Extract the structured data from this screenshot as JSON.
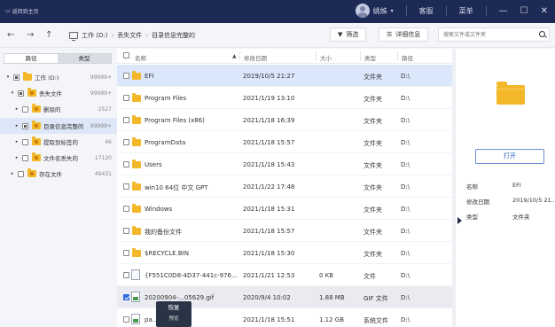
{
  "titlebar": {
    "back_label": "返回到主页",
    "user_name": "姚姊",
    "customer_service": "客服",
    "menu": "菜单",
    "minimize": "—",
    "maximize": "☐",
    "close": "✕"
  },
  "toolbar": {
    "back": "←",
    "forward": "→",
    "up": "↑",
    "path": [
      "工作 (D:)",
      "丢失文件",
      "目录信息完整的"
    ],
    "filter_label": "筛选",
    "details_label": "详细信息",
    "search_placeholder": "搜索文件或文件夹"
  },
  "left_panel": {
    "tabs": [
      "路径",
      "类型"
    ],
    "active_tab": "路径",
    "tree": [
      {
        "label": "工作 (D:)",
        "count": "99999+",
        "expanded": true,
        "check": "partial",
        "selected": false,
        "level": 0
      },
      {
        "label": "丢失文件",
        "count": "99999+",
        "expanded": true,
        "check": "partial",
        "selected": false,
        "level": 1
      },
      {
        "label": "删除的",
        "count": "2527",
        "expanded": false,
        "check": "none",
        "selected": false,
        "level": 2
      },
      {
        "label": "目录信息完整的",
        "count": "99999+",
        "expanded": false,
        "check": "partial",
        "selected": true,
        "level": 2
      },
      {
        "label": "提取到标签的",
        "count": "46",
        "expanded": false,
        "check": "none",
        "selected": false,
        "level": 2
      },
      {
        "label": "文件名丢失的",
        "count": "17120",
        "expanded": false,
        "check": "none",
        "selected": false,
        "level": 2
      },
      {
        "label": "存在文件",
        "count": "49431",
        "expanded": false,
        "check": "none",
        "selected": false,
        "level": 1
      }
    ]
  },
  "file_list": {
    "columns": {
      "name": "名称",
      "date": "修改日期",
      "size": "大小",
      "type": "类型",
      "path": "路径"
    },
    "rows": [
      {
        "name": "EFI",
        "date": "2019/10/5 21:27",
        "size": "",
        "type": "文件夹",
        "path": "D:\\",
        "icon": "folder",
        "checked": false,
        "state": "highlight"
      },
      {
        "name": "Program Files",
        "date": "2021/1/19 13:10",
        "size": "",
        "type": "文件夹",
        "path": "D:\\",
        "icon": "folder",
        "checked": false,
        "state": ""
      },
      {
        "name": "Program Files (x86)",
        "date": "2021/1/18 16:39",
        "size": "",
        "type": "文件夹",
        "path": "D:\\",
        "icon": "folder",
        "checked": false,
        "state": ""
      },
      {
        "name": "ProgramData",
        "date": "2021/1/18 15:57",
        "size": "",
        "type": "文件夹",
        "path": "D:\\",
        "icon": "folder",
        "checked": false,
        "state": ""
      },
      {
        "name": "Users",
        "date": "2021/1/18 15:43",
        "size": "",
        "type": "文件夹",
        "path": "D:\\",
        "icon": "folder",
        "checked": false,
        "state": ""
      },
      {
        "name": "win10 64位 中文 GPT",
        "date": "2021/1/22 17:48",
        "size": "",
        "type": "文件夹",
        "path": "D:\\",
        "icon": "folder",
        "checked": false,
        "state": ""
      },
      {
        "name": "Windows",
        "date": "2021/1/18 15:31",
        "size": "",
        "type": "文件夹",
        "path": "D:\\",
        "icon": "folder",
        "checked": false,
        "state": ""
      },
      {
        "name": "我的备份文件",
        "date": "2021/1/18 15:57",
        "size": "",
        "type": "文件夹",
        "path": "D:\\",
        "icon": "folder",
        "checked": false,
        "state": ""
      },
      {
        "name": "$RECYCLE.BIN",
        "date": "2021/1/18 15:30",
        "size": "",
        "type": "文件夹",
        "path": "D:\\",
        "icon": "folder",
        "checked": false,
        "state": ""
      },
      {
        "name": "{F551C0D8-4D37-441c-976E-...",
        "date": "2021/1/21 12:53",
        "size": "0 KB",
        "type": "文件",
        "path": "D:\\",
        "icon": "doc",
        "checked": false,
        "state": ""
      },
      {
        "name": "20200904-...05629.gif",
        "date": "2020/9/4 10:02",
        "size": "1.88 MB",
        "type": "GIF 文件",
        "path": "D:\\",
        "icon": "gif",
        "checked": true,
        "state": "selected"
      },
      {
        "name": "pa...",
        "date": "2021/1/18 15:51",
        "size": "1.12 GB",
        "type": "系统文件",
        "path": "D:\\",
        "icon": "gif",
        "checked": false,
        "state": ""
      }
    ]
  },
  "context_menu": {
    "recover": "恢复",
    "preview": "预览"
  },
  "details_panel": {
    "open_label": "打开",
    "props": [
      {
        "label": "名称",
        "value": "EFI"
      },
      {
        "label": "修改日期",
        "value": "2019/10/5 21..."
      },
      {
        "label": "类型",
        "value": "文件夹"
      }
    ]
  }
}
